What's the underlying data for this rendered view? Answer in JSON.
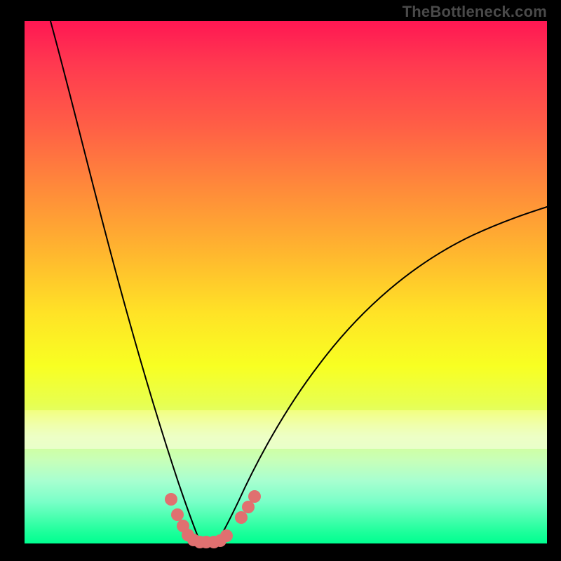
{
  "watermark": "TheBottleneck.com",
  "chart_data": {
    "type": "line",
    "title": "",
    "xlabel": "",
    "ylabel": "",
    "xlim": [
      0,
      100
    ],
    "ylim": [
      0,
      100
    ],
    "grid": false,
    "background_gradient": {
      "direction": "vertical",
      "stops": [
        {
          "pos": 0,
          "color": "#ff1753"
        },
        {
          "pos": 50,
          "color": "#ffe326"
        },
        {
          "pos": 100,
          "color": "#00ff90"
        }
      ]
    },
    "series": [
      {
        "name": "curve-left",
        "x": [
          5,
          10,
          15,
          20,
          23,
          26,
          28,
          30,
          31,
          32,
          33
        ],
        "values": [
          100,
          82,
          62,
          42,
          28,
          16,
          9,
          4,
          2,
          1,
          0
        ]
      },
      {
        "name": "curve-right",
        "x": [
          37,
          38,
          40,
          42,
          45,
          50,
          56,
          63,
          72,
          82,
          92,
          100
        ],
        "values": [
          0,
          1,
          3,
          6,
          10,
          17,
          25,
          33,
          42,
          51,
          58,
          63
        ]
      },
      {
        "name": "curve-flat-bottom",
        "x": [
          33,
          34,
          35,
          36,
          37
        ],
        "values": [
          0,
          0,
          0,
          0,
          0
        ]
      }
    ],
    "markers": {
      "color": "#e07070",
      "radius_pct": 1.2,
      "points": [
        {
          "x": 28.0,
          "y": 8.5
        },
        {
          "x": 29.2,
          "y": 5.5
        },
        {
          "x": 30.3,
          "y": 3.3
        },
        {
          "x": 31.3,
          "y": 1.6
        },
        {
          "x": 32.3,
          "y": 0.6
        },
        {
          "x": 33.5,
          "y": 0.2
        },
        {
          "x": 34.8,
          "y": 0.2
        },
        {
          "x": 36.2,
          "y": 0.2
        },
        {
          "x": 37.5,
          "y": 0.5
        },
        {
          "x": 38.6,
          "y": 1.5
        },
        {
          "x": 41.5,
          "y": 5.0
        },
        {
          "x": 42.8,
          "y": 7.0
        },
        {
          "x": 44.0,
          "y": 9.0
        }
      ]
    }
  }
}
